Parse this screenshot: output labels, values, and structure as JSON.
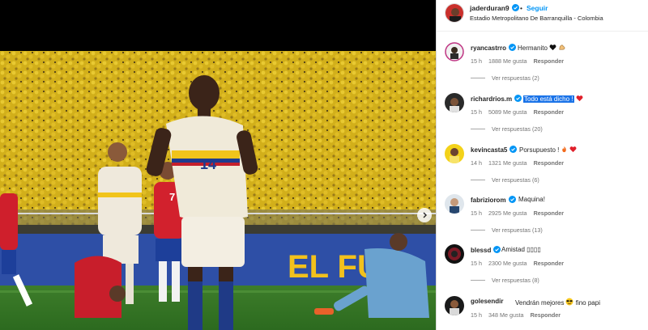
{
  "header": {
    "username": "jaderduran9",
    "separator": "•",
    "follow_label": "Seguir",
    "location": "Estadio Metropolitano De Barranquilla - Colombia"
  },
  "comments": [
    {
      "user": "ryancastrro",
      "text": "Hermanito",
      "emoji": [
        "black-heart",
        "flexed-arm"
      ],
      "time": "15 h",
      "likes": "1888 Me gusta",
      "reply": "Responder",
      "view_replies": "Ver respuestas (2)"
    },
    {
      "user": "richardrios.m",
      "text": "Todo está dicho",
      "selected_suffix": "!",
      "emoji": [
        "red-heart"
      ],
      "time": "15 h",
      "likes": "5089 Me gusta",
      "reply": "Responder",
      "view_replies": "Ver respuestas (20)"
    },
    {
      "user": "kevincasta5",
      "text": "Porsupuesto !",
      "emoji": [
        "fire",
        "red-heart"
      ],
      "time": "14 h",
      "likes": "1321 Me gusta",
      "reply": "Responder",
      "view_replies": "Ver respuestas (6)"
    },
    {
      "user": "fabriziorom",
      "text": "Maquina!",
      "emoji": [],
      "time": "15 h",
      "likes": "2925 Me gusta",
      "reply": "Responder",
      "view_replies": "Ver respuestas (13)"
    },
    {
      "user": "blessd",
      "text": "Amistad ▯▯▯▯",
      "emoji": [],
      "time": "15 h",
      "likes": "2300 Me gusta",
      "reply": "Responder",
      "view_replies": "Ver respuestas (8)"
    },
    {
      "user": "golesendir",
      "text": "Vendrán mejores",
      "text_after": "fino papi",
      "emoji": [
        "sunglasses"
      ],
      "time": "15 h",
      "likes": "348 Me gusta",
      "reply": "Responder",
      "view_replies": ""
    }
  ],
  "colors": {
    "link": "#0095f6",
    "verified": "#0095f6",
    "muted": "#737373",
    "selection": "#1a73e8",
    "heart": "#ed4956"
  }
}
